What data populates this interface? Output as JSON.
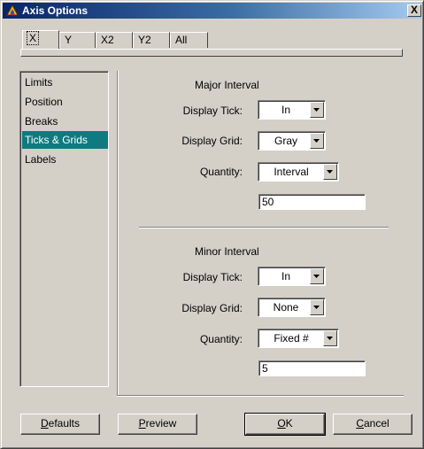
{
  "window": {
    "title": "Axis Options",
    "close_label": "X"
  },
  "tabs": [
    {
      "label": "X",
      "active": true
    },
    {
      "label": "Y",
      "active": false
    },
    {
      "label": "X2",
      "active": false
    },
    {
      "label": "Y2",
      "active": false
    },
    {
      "label": "All",
      "active": false
    }
  ],
  "categories": [
    {
      "label": "Limits"
    },
    {
      "label": "Position"
    },
    {
      "label": "Breaks"
    },
    {
      "label": "Ticks & Grids",
      "selected": true
    },
    {
      "label": "Labels"
    }
  ],
  "major": {
    "title": "Major Interval",
    "display_tick_label": "Display Tick:",
    "display_tick_value": "In",
    "display_grid_label": "Display Grid:",
    "display_grid_value": "Gray",
    "quantity_label": "Quantity:",
    "quantity_value": "Interval",
    "interval_value": "50"
  },
  "minor": {
    "title": "Minor Interval",
    "display_tick_label": "Display Tick:",
    "display_tick_value": "In",
    "display_grid_label": "Display Grid:",
    "display_grid_value": "None",
    "quantity_label": "Quantity:",
    "quantity_value": "Fixed #",
    "count_value": "5"
  },
  "buttons": {
    "defaults": {
      "u": "D",
      "rest": "efaults"
    },
    "preview": {
      "u": "P",
      "rest": "review"
    },
    "ok": {
      "u": "O",
      "rest": "K"
    },
    "cancel": {
      "u": "C",
      "rest": "ancel"
    }
  },
  "colors": {
    "title_bar_start": "#0a246a",
    "title_bar_end": "#a6caf0",
    "selection": "#0f7a80",
    "face": "#d4d0c8"
  },
  "icons": {
    "title": "app-icon",
    "close": "close-icon",
    "dropdown": "chevron-down-icon"
  }
}
